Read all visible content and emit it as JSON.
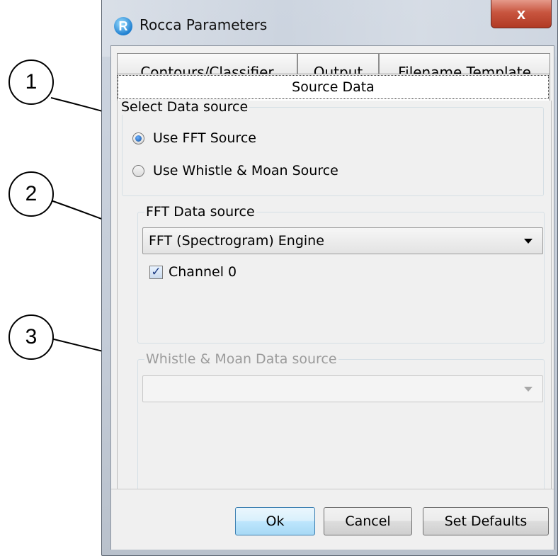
{
  "window": {
    "title": "Rocca Parameters",
    "app_icon_letter": "R",
    "close_glyph": "x"
  },
  "tabs": [
    {
      "label": "Contours/Classifier"
    },
    {
      "label": "Output"
    },
    {
      "label": "Filename Template"
    }
  ],
  "active_tab": {
    "label": "Source Data"
  },
  "select_source": {
    "legend": "Select Data source",
    "options": [
      {
        "label": "Use FFT Source",
        "checked": true
      },
      {
        "label": "Use Whistle & Moan Source",
        "checked": false
      }
    ]
  },
  "fft_source": {
    "legend": "FFT Data source",
    "selected": "FFT (Spectrogram) Engine",
    "channel_label": "Channel 0",
    "channel_checked": true
  },
  "wm_source": {
    "legend": "Whistle & Moan Data source",
    "selected": "",
    "enabled": false
  },
  "buttons": {
    "ok": "Ok",
    "cancel": "Cancel",
    "defaults": "Set Defaults"
  },
  "callouts": [
    "1",
    "2",
    "3"
  ],
  "colors": {
    "accent": "#3c7fb1",
    "close_button": "#c8553f"
  }
}
